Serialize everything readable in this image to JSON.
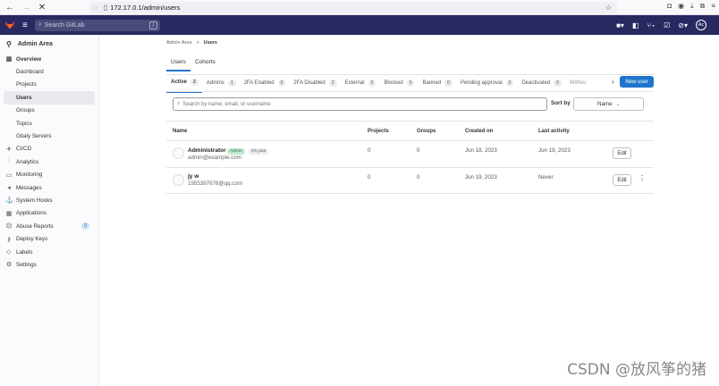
{
  "browser": {
    "url": "172.17.0.1/admin/users"
  },
  "header": {
    "search_placeholder": "Search GitLab",
    "search_kbd": "/",
    "avatar_initials": "Ac"
  },
  "sidebar": {
    "title": "Admin Area",
    "items": [
      {
        "label": "Overview"
      },
      {
        "label": "Dashboard"
      },
      {
        "label": "Projects"
      },
      {
        "label": "Users"
      },
      {
        "label": "Groups"
      },
      {
        "label": "Topics"
      },
      {
        "label": "Gitaly Servers"
      },
      {
        "label": "CI/CD"
      },
      {
        "label": "Analytics"
      },
      {
        "label": "Monitoring"
      },
      {
        "label": "Messages"
      },
      {
        "label": "System Hooks"
      },
      {
        "label": "Applications"
      },
      {
        "label": "Abuse Reports",
        "count": "0"
      },
      {
        "label": "Deploy Keys"
      },
      {
        "label": "Labels"
      },
      {
        "label": "Settings"
      }
    ]
  },
  "breadcrumb": {
    "parent": "Admin Area",
    "sep": ">",
    "current": "Users"
  },
  "top_tabs": [
    "Users",
    "Cohorts"
  ],
  "filter_tabs": [
    {
      "label": "Active",
      "count": "2"
    },
    {
      "label": "Admins",
      "count": "1"
    },
    {
      "label": "2FA Enabled",
      "count": "0"
    },
    {
      "label": "2FA Disabled",
      "count": "2"
    },
    {
      "label": "External",
      "count": "0"
    },
    {
      "label": "Blocked",
      "count": "0"
    },
    {
      "label": "Banned",
      "count": "0"
    },
    {
      "label": "Pending approval",
      "count": "0"
    },
    {
      "label": "Deactivated",
      "count": "0"
    },
    {
      "label": "Withou"
    }
  ],
  "new_user_label": "New user",
  "search_placeholder": "Search by name, email, or username",
  "sort": {
    "label": "Sort by",
    "value": "Name"
  },
  "table": {
    "headers": [
      "Name",
      "Projects",
      "Groups",
      "Created on",
      "Last activity"
    ],
    "rows": [
      {
        "name": "Administrator",
        "badge_admin": "Admin",
        "badge_you": "It's you!",
        "email": "admin@example.com",
        "projects": "0",
        "groups": "0",
        "created": "Jun 18, 2023",
        "last": "Jun 19, 2023",
        "edit": "Edit"
      },
      {
        "name": "jy w",
        "email": "1955397676@qq.com",
        "projects": "0",
        "groups": "0",
        "created": "Jun 19, 2023",
        "last": "Never",
        "edit": "Edit"
      }
    ]
  },
  "watermark": "CSDN @放风筝的猪",
  "colors": {
    "header_bg": "#292961",
    "accent": "#1f75cb",
    "logo": "#e24329"
  }
}
